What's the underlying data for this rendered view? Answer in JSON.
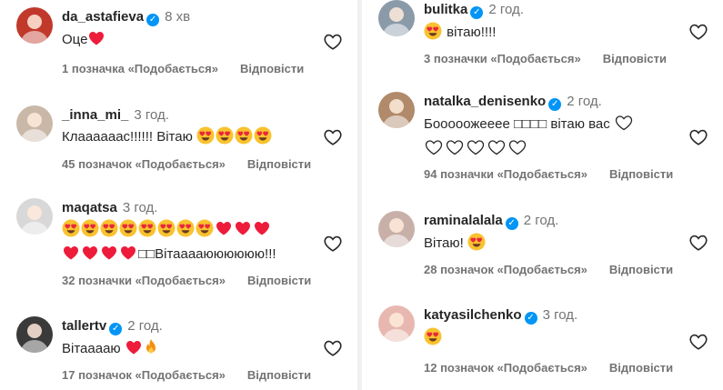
{
  "left": [
    {
      "username": "da_astafieva",
      "verified": true,
      "time": "8 хв",
      "segments": [
        {
          "t": "text",
          "v": "Оце"
        },
        {
          "t": "heart"
        }
      ],
      "likes": "1 позначка «Подобається»",
      "reply": "Відповісти",
      "avatar_color": "#c0392b"
    },
    {
      "username": "_inna_mi_",
      "verified": false,
      "time": "3 год.",
      "segments": [
        {
          "t": "text",
          "v": "Клаааааас!!!!!! Вітаю "
        },
        {
          "t": "love"
        },
        {
          "t": "love"
        },
        {
          "t": "love"
        },
        {
          "t": "love"
        }
      ],
      "likes": "45 позначок «Подобається»",
      "reply": "Відповісти",
      "avatar_color": "#c9b8a8"
    },
    {
      "username": "maqatsa",
      "verified": false,
      "time": "3 год.",
      "segments": [
        {
          "t": "love"
        },
        {
          "t": "love"
        },
        {
          "t": "love"
        },
        {
          "t": "love"
        },
        {
          "t": "love"
        },
        {
          "t": "love"
        },
        {
          "t": "love"
        },
        {
          "t": "love"
        },
        {
          "t": "heart"
        },
        {
          "t": "heart"
        },
        {
          "t": "heart"
        },
        {
          "t": "br"
        },
        {
          "t": "heart"
        },
        {
          "t": "heart"
        },
        {
          "t": "heart"
        },
        {
          "t": "heart"
        },
        {
          "t": "text",
          "v": "□□Вітааааюююююю!!!"
        }
      ],
      "likes": "32 позначки «Подобається»",
      "reply": "Відповісти",
      "avatar_color": "#d8d8d8"
    },
    {
      "username": "tallertv",
      "verified": true,
      "time": "2 год.",
      "segments": [
        {
          "t": "text",
          "v": "Вітааааю "
        },
        {
          "t": "heart"
        },
        {
          "t": "fire"
        }
      ],
      "likes": "17 позначок «Подобається»",
      "reply": "Відповісти",
      "avatar_color": "#3a3a3a"
    }
  ],
  "right": [
    {
      "username": "bulitka",
      "verified": true,
      "time": "2 год.",
      "segments": [
        {
          "t": "love"
        },
        {
          "t": "text",
          "v": " вітаю!!!!"
        }
      ],
      "likes": "3 позначки «Подобається»",
      "reply": "Відповісти",
      "avatar_color": "#8a9aa8"
    },
    {
      "username": "natalka_denisenko",
      "verified": true,
      "time": "2 год.",
      "segments": [
        {
          "t": "text",
          "v": "Бооооожееее □□□□ вітаю вас "
        },
        {
          "t": "outline"
        },
        {
          "t": "br"
        },
        {
          "t": "outline"
        },
        {
          "t": "outline"
        },
        {
          "t": "outline"
        },
        {
          "t": "outline"
        },
        {
          "t": "outline"
        }
      ],
      "likes": "94 позначки «Подобається»",
      "reply": "Відповісти",
      "avatar_color": "#b08a6a"
    },
    {
      "username": "raminalalala",
      "verified": true,
      "time": "2 год.",
      "segments": [
        {
          "t": "text",
          "v": "Вітаю! "
        },
        {
          "t": "love"
        }
      ],
      "likes": "28 позначок «Подобається»",
      "reply": "Відповісти",
      "avatar_color": "#c8b0a8"
    },
    {
      "username": "katyasilchenko",
      "verified": true,
      "time": "3 год.",
      "segments": [
        {
          "t": "love"
        }
      ],
      "likes": "12 позначок «Подобається»",
      "reply": "Відповісти",
      "avatar_color": "#e8b8b0"
    }
  ],
  "colors": {
    "accent_verified": "#0095f6",
    "muted_text": "#737373",
    "heart_red": "#ed1c3a"
  }
}
